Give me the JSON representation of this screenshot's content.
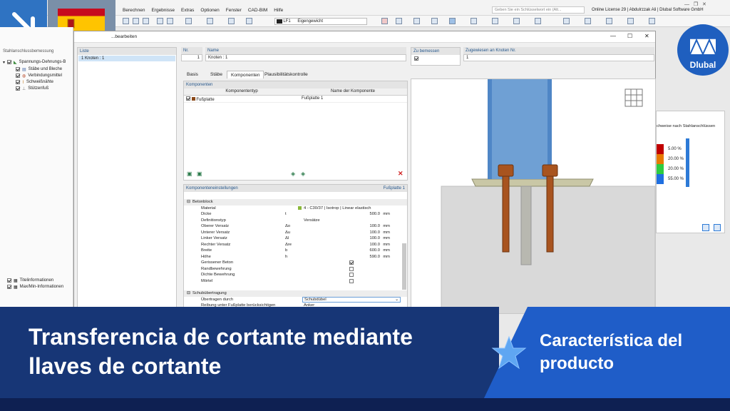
{
  "menu": [
    "Berechnen",
    "Ergebnisse",
    "Extras",
    "Optionen",
    "Fenster",
    "CAD-BIM",
    "Hilfe"
  ],
  "toolbar": {
    "load_case": "LF1",
    "load_case_name": "Eigengewicht",
    "search_placeholder": "Geben Sie ein Schlüsselwort ein (Alt...",
    "license": "Online License 29 | Abdulrzzak Ali | Dlubal Software GmbH"
  },
  "nav": {
    "title": "Stahlanschlussbemessung",
    "items": [
      "Spannungs-Dehnungs-B",
      "Stäbe und Bleche",
      "Verbindungsmittel",
      "Schweißnähte",
      "Stützenfuß"
    ],
    "bottom_items": [
      "Titelinformationen",
      "Max/Min-Informationen"
    ]
  },
  "dialog": {
    "title": "...bearbeiten",
    "list_header": "Liste",
    "list_item": "1  Knoten : 1",
    "nr_label": "Nr.",
    "nr_value": "1",
    "name_label": "Name",
    "name_value": "Knoten : 1",
    "zu_label": "Zu bemessen",
    "assigned_label": "Zugewiesen an Knoten Nr.",
    "assigned_value": "1",
    "tabs": [
      "Basis",
      "Stäbe",
      "Komponenten",
      "Plausibilitätskontrolle"
    ],
    "comp_header": "Komponenten",
    "col_type": "Komponententyp",
    "col_name": "Name der Komponente",
    "comp_type": "Fußplatte",
    "comp_name": "Fußplatte 1",
    "settings_header": "Komponenteneinstellungen",
    "settings_right": "Fußplatte 1",
    "group1": "Betonblock",
    "rows": [
      {
        "label": "Material",
        "sym": "",
        "val": "4 - C30/37 | Isotrop | Linear elastisch",
        "num": "",
        "unit": ""
      },
      {
        "label": "Dicke",
        "sym": "t",
        "val": "",
        "num": "500.0",
        "unit": "mm"
      },
      {
        "label": "Definitionstyp",
        "sym": "",
        "val": "Versätze",
        "num": "",
        "unit": ""
      },
      {
        "label": "Oberer Versatz",
        "sym": "Δo",
        "val": "",
        "num": "100.0",
        "unit": "mm"
      },
      {
        "label": "Unterer Versatz",
        "sym": "Δu",
        "val": "",
        "num": "100.0",
        "unit": "mm"
      },
      {
        "label": "Linker Versatz",
        "sym": "Δl",
        "val": "",
        "num": "100.0",
        "unit": "mm"
      },
      {
        "label": "Rechter Versatz",
        "sym": "Δre",
        "val": "",
        "num": "100.0",
        "unit": "mm"
      },
      {
        "label": "Breite",
        "sym": "b",
        "val": "",
        "num": "600.0",
        "unit": "mm"
      },
      {
        "label": "Höhe",
        "sym": "h",
        "val": "",
        "num": "590.0",
        "unit": "mm"
      },
      {
        "label": "Gerissener Beton",
        "sym": "",
        "val": "",
        "num": "",
        "unit": ""
      },
      {
        "label": "Randbewehrung",
        "sym": "",
        "val": "",
        "num": "",
        "unit": ""
      },
      {
        "label": "Dichte Bewehrung",
        "sym": "",
        "val": "",
        "num": "",
        "unit": ""
      },
      {
        "label": "Mörtel",
        "sym": "",
        "val": "",
        "num": "",
        "unit": ""
      }
    ],
    "group2": "Schubübertragung",
    "shear_row": "Übertragen durch",
    "shear_value": "Schubdübel",
    "shear_option": "Anker",
    "friction_row": "Reibung unter Fußplatte berücksichtigen"
  },
  "results": {
    "title": "chweise nach Stahlanschlüssen",
    "values": [
      "5.00 %",
      "20.00 %",
      "20.00 %",
      "55.00 %"
    ],
    "colors": [
      "#c00000",
      "#e87a00",
      "#2ecc40",
      "#1f6fe0"
    ]
  },
  "banner": {
    "title": "Transferencia de cortante mediante llaves de cortante",
    "tag": "Característica del producto"
  },
  "logo": "Dlubal"
}
